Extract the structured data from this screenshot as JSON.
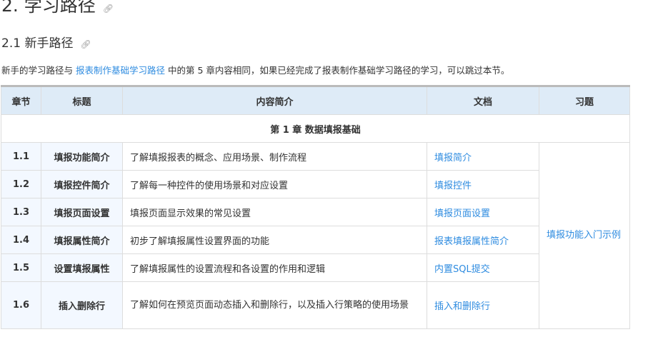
{
  "headings": {
    "h2": "2. 学习路径",
    "h3": "2.1 新手路径"
  },
  "intro": {
    "before": "新手的学习路径与 ",
    "link": "报表制作基础学习路径",
    "after": " 中的第 5 章内容相同，如果已经完成了报表制作基础学习路径的学习，可以跳过本节。"
  },
  "table": {
    "headers": [
      "章节",
      "标题",
      "内容简介",
      "文档",
      "习题"
    ],
    "chapter": "第 1 章 数据填报基础",
    "rows": [
      {
        "num": "1.1",
        "title": "填报功能简介",
        "desc": "了解填报报表的概念、应用场景、制作流程",
        "doc": "填报简介"
      },
      {
        "num": "1.2",
        "title": "填报控件简介",
        "desc": "了解每一种控件的使用场景和对应设置",
        "doc": "填报控件"
      },
      {
        "num": "1.3",
        "title": "填报页面设置",
        "desc": "填报页面显示效果的常见设置",
        "doc": "填报页面设置"
      },
      {
        "num": "1.4",
        "title": "填报属性简介",
        "desc": "初步了解填报属性设置界面的功能",
        "doc": "报表填报属性简介"
      },
      {
        "num": "1.5",
        "title": "设置填报属性",
        "desc": "了解填报属性的设置流程和各设置的作用和逻辑",
        "doc": "内置SQL提交"
      },
      {
        "num": "1.6",
        "title": "插入删除行",
        "desc": "了解如何在预览页面动态插入和删除行，以及插入行策略的使用场景",
        "doc": "插入和删除行"
      }
    ],
    "exercise": "填报功能入门示例"
  }
}
